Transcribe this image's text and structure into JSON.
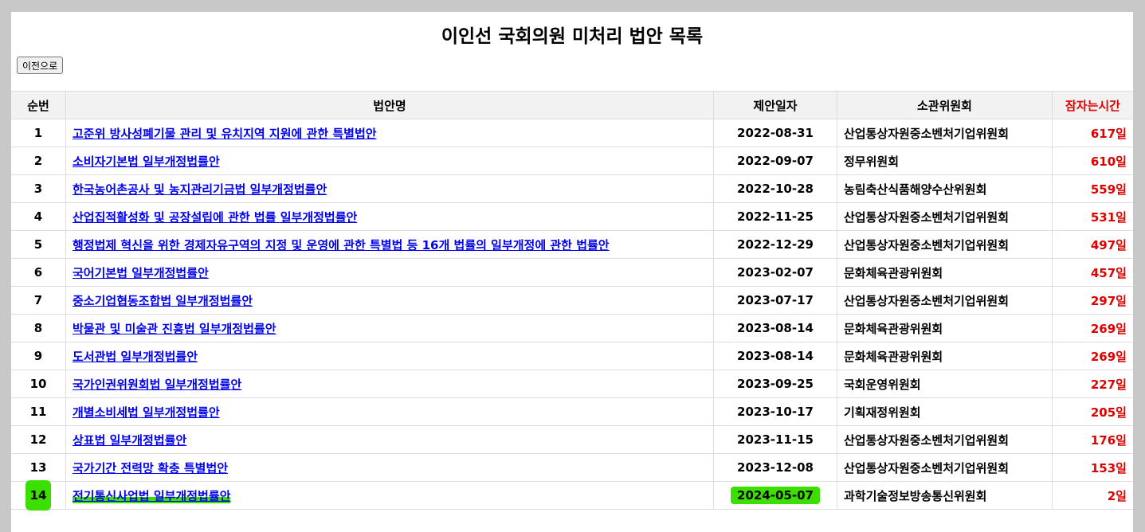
{
  "page": {
    "title": "이인선 국회의원 미처리 법안 목록",
    "back_label": "이전으로"
  },
  "table": {
    "headers": {
      "num": "순번",
      "title": "법안명",
      "date": "제안일자",
      "committee": "소관위원회",
      "days": "잠자는시간"
    },
    "rows": [
      {
        "num": "1",
        "title": "고준위 방사성폐기물 관리 및 유치지역 지원에 관한 특별법안",
        "date": "2022-08-31",
        "committee": "산업통상자원중소벤처기업위원회",
        "days": "617일"
      },
      {
        "num": "2",
        "title": "소비자기본법 일부개정법률안",
        "date": "2022-09-07",
        "committee": "정무위원회",
        "days": "610일"
      },
      {
        "num": "3",
        "title": "한국농어촌공사 및 농지관리기금법 일부개정법률안",
        "date": "2022-10-28",
        "committee": "농림축산식품해양수산위원회",
        "days": "559일"
      },
      {
        "num": "4",
        "title": "산업집적활성화 및 공장설립에 관한 법률 일부개정법률안",
        "date": "2022-11-25",
        "committee": "산업통상자원중소벤처기업위원회",
        "days": "531일"
      },
      {
        "num": "5",
        "title": "행정법제 혁신을 위한 경제자유구역의 지정 및 운영에 관한 특별법 등 16개 법률의 일부개정에 관한 법률안",
        "date": "2022-12-29",
        "committee": "산업통상자원중소벤처기업위원회",
        "days": "497일"
      },
      {
        "num": "6",
        "title": "국어기본법 일부개정법률안",
        "date": "2023-02-07",
        "committee": "문화체육관광위원회",
        "days": "457일"
      },
      {
        "num": "7",
        "title": "중소기업협동조합법 일부개정법률안",
        "date": "2023-07-17",
        "committee": "산업통상자원중소벤처기업위원회",
        "days": "297일"
      },
      {
        "num": "8",
        "title": "박물관 및 미술관 진흥법 일부개정법률안",
        "date": "2023-08-14",
        "committee": "문화체육관광위원회",
        "days": "269일"
      },
      {
        "num": "9",
        "title": "도서관법 일부개정법률안",
        "date": "2023-08-14",
        "committee": "문화체육관광위원회",
        "days": "269일"
      },
      {
        "num": "10",
        "title": "국가인권위원회법 일부개정법률안",
        "date": "2023-09-25",
        "committee": "국회운영위원회",
        "days": "227일"
      },
      {
        "num": "11",
        "title": "개별소비세법 일부개정법률안",
        "date": "2023-10-17",
        "committee": "기획재정위원회",
        "days": "205일"
      },
      {
        "num": "12",
        "title": "상표법 일부개정법률안",
        "date": "2023-11-15",
        "committee": "산업통상자원중소벤처기업위원회",
        "days": "176일"
      },
      {
        "num": "13",
        "title": "국가기간 전력망 확충 특별법안",
        "date": "2023-12-08",
        "committee": "산업통상자원중소벤처기업위원회",
        "days": "153일"
      },
      {
        "num": "14",
        "title": "전기통신사업법 일부개정법률안",
        "date": "2024-05-07",
        "committee": "과학기술정보방송통신위원회",
        "days": "2일",
        "highlighted": true
      }
    ]
  },
  "colors": {
    "days_text": "#e00000",
    "link": "#0000ee",
    "highlight": "#3ce000",
    "header_bg": "#f2f2f2"
  }
}
